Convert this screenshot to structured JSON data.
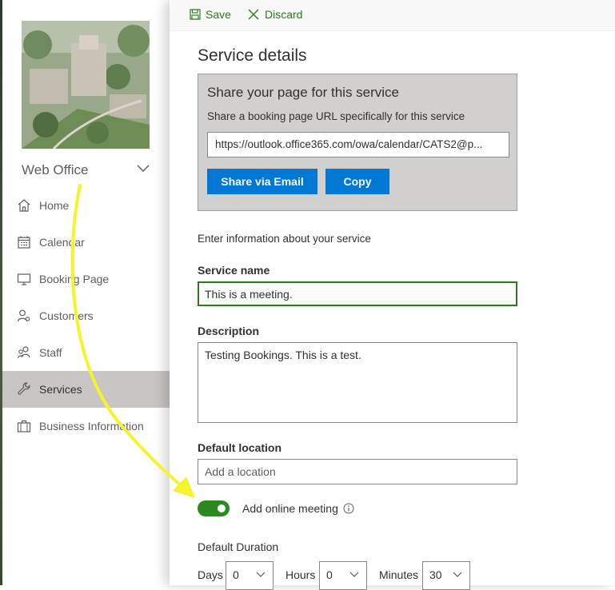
{
  "sidebar": {
    "office_name": "Web Office",
    "nav": [
      {
        "label": "Home",
        "icon": "home-icon"
      },
      {
        "label": "Calendar",
        "icon": "calendar-icon"
      },
      {
        "label": "Booking Page",
        "icon": "monitor-icon"
      },
      {
        "label": "Customers",
        "icon": "customers-icon"
      },
      {
        "label": "Staff",
        "icon": "staff-icon"
      },
      {
        "label": "Services",
        "icon": "wrench-icon",
        "active": true
      },
      {
        "label": "Business Information",
        "icon": "briefcase-icon"
      }
    ]
  },
  "toolbar": {
    "save_label": "Save",
    "discard_label": "Discard"
  },
  "panel": {
    "title": "Service details",
    "share": {
      "title": "Share your page for this service",
      "subtitle": "Share a booking page URL specifically for this service",
      "url": "https://outlook.office365.com/owa/calendar/CATS2@p...",
      "email_button": "Share via Email",
      "copy_button": "Copy"
    },
    "intro": "Enter information about your service",
    "service_name": {
      "label": "Service name",
      "value": "This is a meeting."
    },
    "description": {
      "label": "Description",
      "value": "Testing Bookings. This is a test."
    },
    "location": {
      "label": "Default location",
      "placeholder": "Add a location"
    },
    "online_meeting": {
      "label": "Add online meeting",
      "enabled": true
    },
    "duration": {
      "label": "Default Duration",
      "days_label": "Days",
      "days_value": "0",
      "hours_label": "Hours",
      "hours_value": "0",
      "minutes_label": "Minutes",
      "minutes_value": "30"
    }
  },
  "colors": {
    "accent_green": "#2b7a1f",
    "primary_blue": "#0078d4",
    "annotation_arrow": "#f4f42a",
    "active_nav": "#c8c6c4"
  }
}
